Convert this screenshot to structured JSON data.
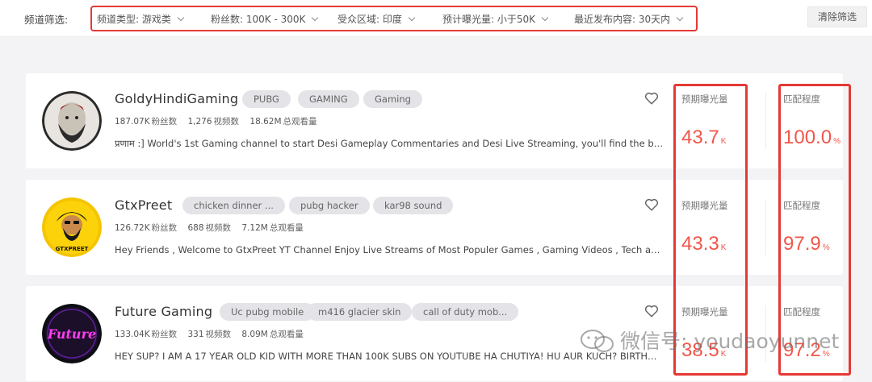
{
  "filter_bar": {
    "label": "频道筛选:",
    "filters": [
      {
        "label": "频道类型: 游戏类"
      },
      {
        "label": "粉丝数: 100K - 300K"
      },
      {
        "label": "受众区域: 印度"
      },
      {
        "label": "预计曝光量: 小于50K"
      },
      {
        "label": "最近发布内容: 30天内"
      }
    ],
    "clear_button": "清除筛选"
  },
  "channels": [
    {
      "name": "GoldyHindiGaming",
      "tags": [
        "PUBG",
        "GAMING",
        "Gaming"
      ],
      "subscribers": "187.07K",
      "subscribers_unit": "粉丝数",
      "videos": "1,276",
      "videos_unit": "视频数",
      "views": "18.62M",
      "views_unit": "总观看量",
      "description": "प्रणाम :] World's 1st Gaming channel to start Desi Gameplay Commentaries and Desi Live Streaming, you'll find the best funny, gameplay moments and a whole lot more...",
      "exposure_label": "预期曝光量",
      "exposure_value": "43.7",
      "exposure_suffix": "K",
      "match_label": "匹配程度",
      "match_value": "100.0",
      "match_suffix": "%"
    },
    {
      "name": "GtxPreet",
      "tags": [
        "chicken dinner ...",
        "pubg hacker",
        "kar98 sound"
      ],
      "subscribers": "126.72K",
      "subscribers_unit": "粉丝数",
      "videos": "688",
      "videos_unit": "视频数",
      "views": "7.12M",
      "views_unit": "总观看量",
      "description": "Hey Friends , Welcome to GtxPreet YT Channel Enjoy Live Streams of Most Populer Games , Gaming Videos , Tech and Gaming Videos and more...",
      "exposure_label": "预期曝光量",
      "exposure_value": "43.3",
      "exposure_suffix": "K",
      "match_label": "匹配程度",
      "match_value": "97.9",
      "match_suffix": "%",
      "avatar_text": "GTXPREET"
    },
    {
      "name": "Future Gaming",
      "tags": [
        "Uc pubg mobile",
        "m416 glacier skin",
        "call of duty mob..."
      ],
      "subscribers": "133.04K",
      "subscribers_unit": "粉丝数",
      "videos": "331",
      "videos_unit": "视频数",
      "views": "8.09M",
      "views_unit": "总观看量",
      "description": "HEY SUP? I AM A 17 YEAR OLD KID WITH MORE THAN 100K SUBS ON YOUTUBE HA CHUTIYA! HU AUR KUCH? BIRTHDAY ON ...",
      "exposure_label": "预期曝光量",
      "exposure_value": "38.5",
      "exposure_suffix": "K",
      "match_label": "匹配程度",
      "match_value": "97.2",
      "match_suffix": "%",
      "avatar_text": "Future"
    }
  ],
  "watermark": "微信号: youdaoyunnet",
  "colors": {
    "accent": "#f1564a",
    "annotation": "#e53935"
  },
  "icons": [
    "heart-icon",
    "chevron-down-icon",
    "wechat-icon"
  ]
}
